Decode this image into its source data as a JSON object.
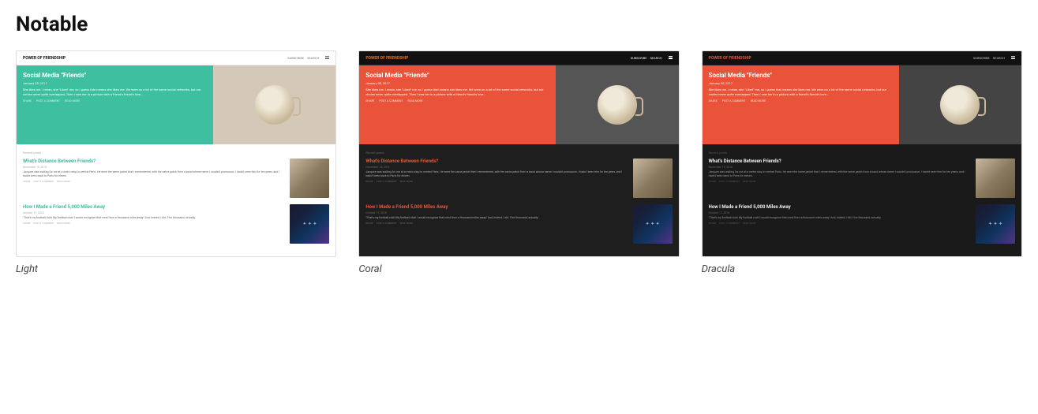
{
  "page": {
    "title": "Notable"
  },
  "themes": [
    {
      "id": "light",
      "label": "Light",
      "nav": {
        "site_name": "POWER OF FRIENDSHIP",
        "links": [
          "SUBSCRIBE",
          "SEARCH"
        ]
      },
      "hero": {
        "title": "Social Media \"Friends\"",
        "date": "January 05, 2017",
        "excerpt": "She likes me. I mean, she \"Liked\" me, so I guess that means she likes me.\n\nWe were on a lot of the same social networks, but our circles never quite overlapped. Then I saw her in a picture with a friend's friend's love...",
        "actions": [
          "SHARE",
          "POST A COMMENT",
          "READ MORE"
        ]
      },
      "posts": [
        {
          "title": "What's Distance Between Friends?",
          "date": "November 15, 2016",
          "excerpt": "Jacques was waiting for me at a metro stop in central Paris. He wore the same jacket that I remembered, with the same patch from a band whose name I couldn't pronounce. I hadn't seen him for ten years, and I hadn't been back to Paris for eleven.",
          "actions": [
            "SHARE",
            "POST A COMMENT",
            "READ MORE"
          ],
          "thumb_type": "paris"
        },
        {
          "title": "How I Made a Friend 5,000 Miles Away",
          "date": "October 17, 2016",
          "excerpt": "\"That's my football club! My football club! I would recognize that crest from a thousand miles away\" And, indeed, I did. Five thousand, actually.",
          "actions": [
            "SHARE",
            "POST A COMMENT",
            "READ MORE"
          ],
          "thumb_type": "space"
        }
      ],
      "section_label": "Recent posts"
    },
    {
      "id": "coral",
      "label": "Coral",
      "nav": {
        "site_name": "POWER OF FRIENDSHIP",
        "links": [
          "SUBSCRIBE",
          "SEARCH"
        ]
      },
      "hero": {
        "title": "Social Media \"Friends\"",
        "date": "January 05, 2017",
        "excerpt": "She likes me. I mean, she \"Liked\" me, so I guess that means she likes me.\n\nWe were on a lot of the same social networks, but our circles never quite overlapped. Then I saw her in a picture with a friend's friend's love...",
        "actions": [
          "SHARE",
          "POST A COMMENT",
          "READ MORE"
        ]
      },
      "posts": [
        {
          "title": "What's Distance Between Friends?",
          "date": "November 15, 2016",
          "excerpt": "Jacques was waiting for me at a metro stop in central Paris. He wore the same jacket that I remembered, with the same patch from a band whose name I couldn't pronounce. I hadn't seen him for ten years, and I hadn't been back to Paris for eleven.",
          "actions": [
            "SHARE",
            "POST A COMMENT",
            "READ MORE"
          ],
          "thumb_type": "paris"
        },
        {
          "title": "How I Made a Friend 5,000 Miles Away",
          "date": "October 17, 2016",
          "excerpt": "\"That's my football club! My football club! I would recognize that crest from a thousand miles away\" And, indeed, I did. Five thousand, actually.",
          "actions": [
            "SHARE",
            "POST A COMMENT",
            "READ MORE"
          ],
          "thumb_type": "space"
        }
      ],
      "section_label": "Recent posts"
    },
    {
      "id": "dracula",
      "label": "Dracula",
      "nav": {
        "site_name": "POWER OF FRIENDSHIP",
        "links": [
          "SUBSCRIBE",
          "SEARCH"
        ]
      },
      "hero": {
        "title": "Social Media \"Friends\"",
        "date": "January 05, 2017",
        "excerpt": "She likes me. I mean, she \"Liked\" me, so I guess that means she likes me.\n\nWe were on a lot of the same social networks, but our circles never quite overlapped. Then I saw her in a picture with a friend's friend's love...",
        "actions": [
          "SHARE",
          "POST A COMMENT",
          "READ MORE"
        ]
      },
      "posts": [
        {
          "title": "What's Distance Between Friends?",
          "date": "November 15, 2016",
          "excerpt": "Jacques was waiting for me at a metro stop in central Paris. He wore the same jacket that I remembered, with the same patch from a band whose name I couldn't pronounce. I hadn't seen him for ten years, and I hadn't been back to Paris for eleven.",
          "actions": [
            "SHARE",
            "POST A COMMENT",
            "READ MORE"
          ],
          "thumb_type": "paris"
        },
        {
          "title": "How I Made a Friend 5,000 Miles Away",
          "date": "October 17, 2016",
          "excerpt": "\"That's my football club! My football club! I would recognize that crest from a thousand miles away\" And, indeed, I did. Five thousand, actually.",
          "actions": [
            "SHARE",
            "POST A COMMENT",
            "READ MORE"
          ],
          "thumb_type": "space"
        }
      ],
      "section_label": "Recent posts"
    }
  ]
}
